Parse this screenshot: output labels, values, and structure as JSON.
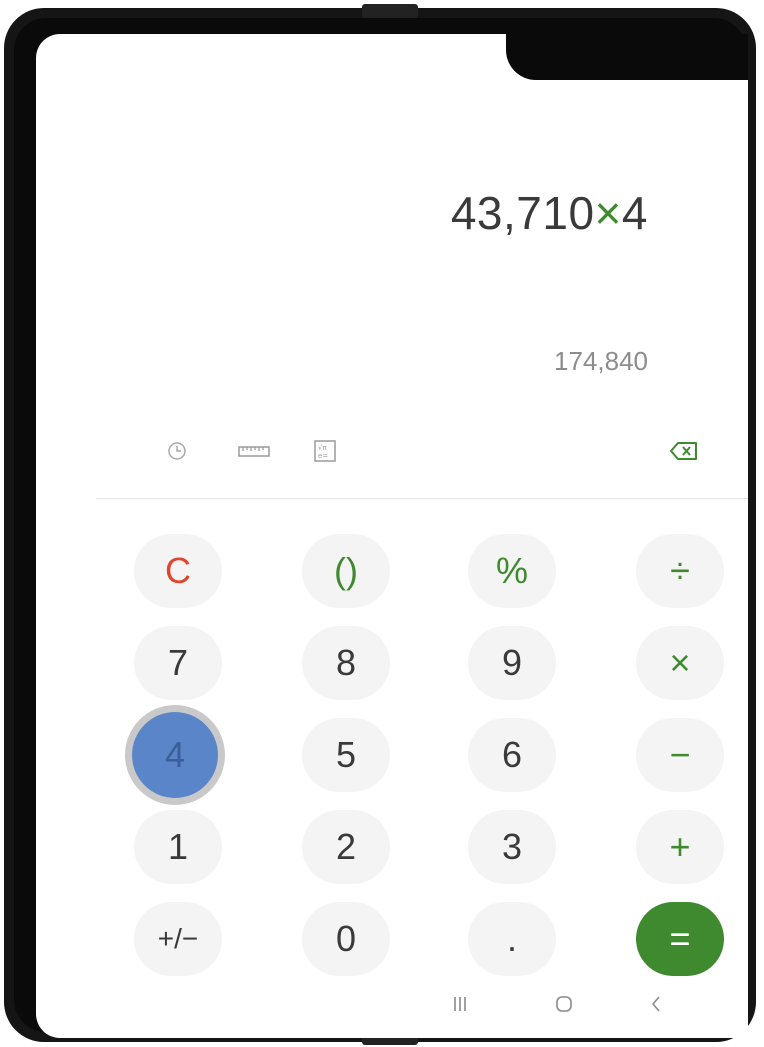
{
  "display": {
    "expression_number": "43,710",
    "expression_operator": "×",
    "expression_operand": "4",
    "result_preview": "174,840"
  },
  "toolbar": {
    "icons": [
      "history-icon",
      "unit-converter-icon",
      "scientific-mode-icon",
      "backspace-icon"
    ]
  },
  "keypad": {
    "rows": [
      [
        "C",
        "()",
        "%",
        "÷"
      ],
      [
        "7",
        "8",
        "9",
        "×"
      ],
      [
        "4",
        "5",
        "6",
        "−"
      ],
      [
        "1",
        "2",
        "3",
        "+"
      ],
      [
        "+/−",
        "0",
        ".",
        "="
      ]
    ],
    "pressed_key": "4"
  },
  "colors": {
    "accent_green": "#3f8a2e",
    "clear_red": "#e0462b",
    "pressed_blue": "#5a86c9"
  },
  "navbar": {
    "items": [
      "recent-apps-icon",
      "home-icon",
      "back-icon"
    ]
  }
}
